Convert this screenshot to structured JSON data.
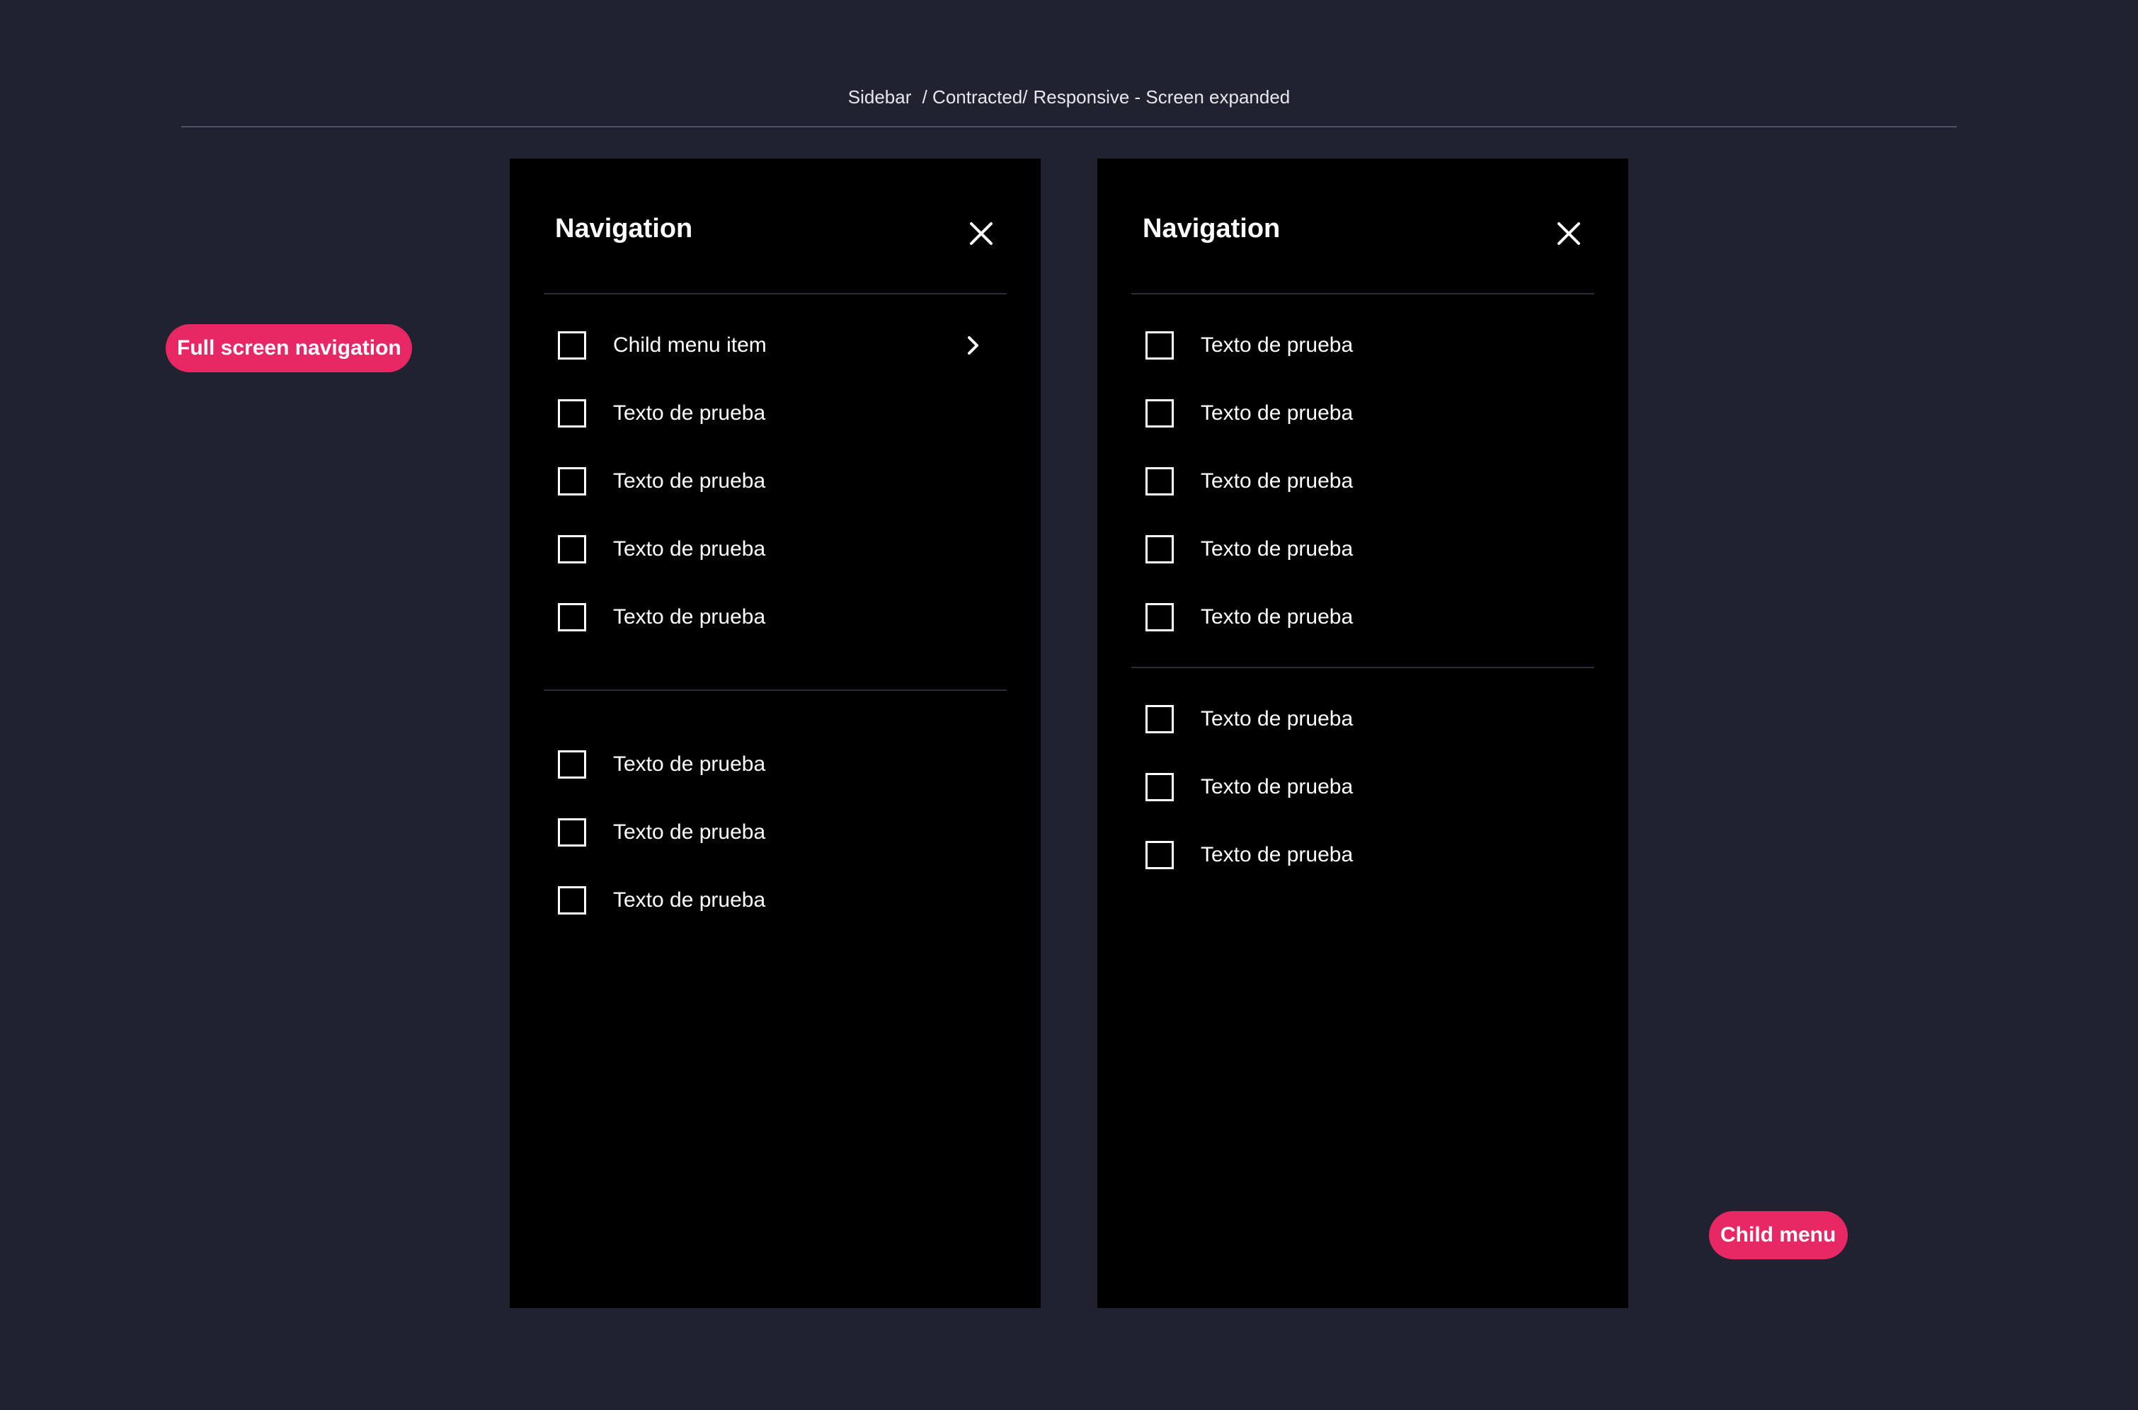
{
  "breadcrumb": {
    "part1": "Sidebar",
    "part2": "/ Contracted/",
    "part3": "Responsive - Screen expanded"
  },
  "tags": {
    "full_screen": "Full screen navigation",
    "child_menu": "Child menu"
  },
  "colors": {
    "background": "#20222f",
    "panel": "#000000",
    "accent": "#e82864",
    "divider": "#2a2c3c"
  },
  "panel_full": {
    "title": "Navigation",
    "close_icon": "close-icon",
    "group1": [
      {
        "label": "Child menu item",
        "has_chevron": true
      },
      {
        "label": "Texto de prueba"
      },
      {
        "label": "Texto de prueba"
      },
      {
        "label": "Texto de prueba"
      },
      {
        "label": "Texto de prueba"
      }
    ],
    "group2": [
      {
        "label": "Texto de prueba"
      },
      {
        "label": "Texto de prueba"
      },
      {
        "label": "Texto de prueba"
      }
    ]
  },
  "panel_child": {
    "title": "Navigation",
    "close_icon": "close-icon",
    "group1": [
      {
        "label": "Texto de prueba"
      },
      {
        "label": "Texto de prueba"
      },
      {
        "label": "Texto de prueba"
      },
      {
        "label": "Texto de prueba"
      },
      {
        "label": "Texto de prueba"
      }
    ],
    "group2": [
      {
        "label": "Texto de prueba"
      },
      {
        "label": "Texto de prueba"
      },
      {
        "label": "Texto de prueba"
      }
    ]
  }
}
